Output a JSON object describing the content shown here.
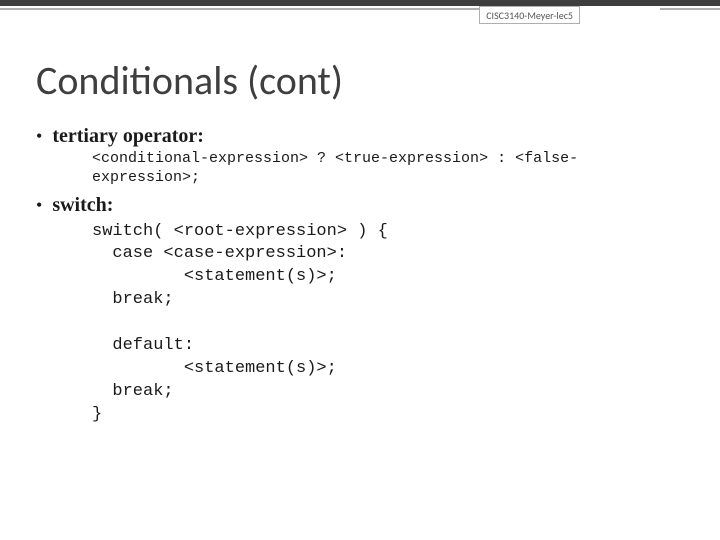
{
  "header": {
    "badge": "CISC3140-Meyer-lec5"
  },
  "title": "Conditionals (cont)",
  "bullets": [
    {
      "label": "tertiary operator:",
      "code": "<conditional-expression> ? <true-expression> : <false-\nexpression>;",
      "code_class": "mono-sub"
    },
    {
      "label": "switch:",
      "code": "switch( <root-expression> ) {\n  case <case-expression>:\n         <statement(s)>;\n  break;\n\n  default:\n         <statement(s)>;\n  break;\n}",
      "code_class": "mono-block"
    }
  ]
}
